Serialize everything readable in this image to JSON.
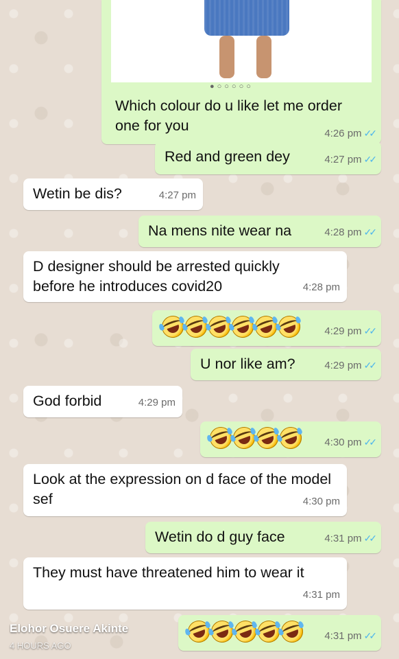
{
  "image_bubble": {
    "text_line1": "Which colour do u like let me order",
    "text_line2": "one for you",
    "time": "4:26 pm",
    "carousel_dots": "●○○○○○"
  },
  "messages": [
    {
      "dir": "out",
      "text": "Red and green dey",
      "time": "4:27 pm",
      "ticks": "✓✓"
    },
    {
      "dir": "in",
      "text": "Wetin be dis?",
      "time": "4:27 pm"
    },
    {
      "dir": "out",
      "text": "Na mens nite wear na",
      "time": "4:28 pm",
      "ticks": "✓✓"
    },
    {
      "dir": "in",
      "text": "D designer should be arrested quickly before he introduces covid20",
      "time": "4:28 pm"
    },
    {
      "dir": "out",
      "emoji_count": 6,
      "emoji_name": "rolling-on-floor-laughing",
      "time": "4:29 pm",
      "ticks": "✓✓"
    },
    {
      "dir": "out",
      "text": "U nor like am?",
      "time": "4:29 pm",
      "ticks": "✓✓"
    },
    {
      "dir": "in",
      "text": "God forbid",
      "time": "4:29 pm"
    },
    {
      "dir": "out",
      "emoji_count": 4,
      "emoji_name": "rolling-on-floor-laughing",
      "time": "4:30 pm",
      "ticks": "✓✓"
    },
    {
      "dir": "in",
      "text": "Look at the expression on d face of the model sef",
      "time": "4:30 pm"
    },
    {
      "dir": "out",
      "text": "Wetin do d guy face",
      "time": "4:31 pm",
      "ticks": "✓✓"
    },
    {
      "dir": "in",
      "text": "They must have threatened him to wear it",
      "time": "4:31 pm"
    },
    {
      "dir": "out",
      "emoji_count": 5,
      "emoji_name": "rolling-on-floor-laughing",
      "time": "4:31 pm",
      "ticks": "✓✓"
    }
  ],
  "overlay": {
    "author": "Elohor Osuere Akinte",
    "posted": "4 HOURS AGO"
  },
  "colors": {
    "outgoing_bubble": "#dcf8c6",
    "incoming_bubble": "#ffffff",
    "read_ticks": "#4fb6ec",
    "wallpaper": "#e7ddd3"
  }
}
